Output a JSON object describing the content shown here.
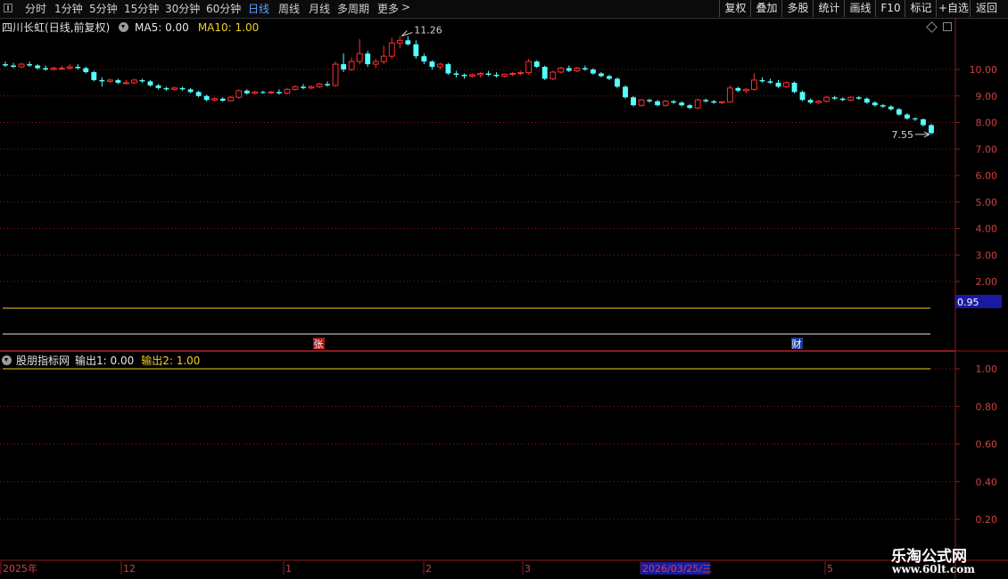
{
  "toolbar": {
    "periods": [
      "分时",
      "1分钟",
      "5分钟",
      "15分钟",
      "30分钟",
      "60分钟",
      "日线",
      "周线",
      "月线",
      "多周期",
      "更多"
    ],
    "more_arrow": ">",
    "active_period": "日线",
    "buttons": [
      "复权",
      "叠加",
      "多股",
      "统计",
      "画线",
      "F10",
      "标记",
      "+自选",
      "返回"
    ]
  },
  "main_panel": {
    "stock_name": "四川长虹",
    "mode": "(日线,前复权)",
    "ma5_label": "MA5: 0.00",
    "ma10_label": "MA10: 1.00",
    "high_marker": "11.26",
    "low_marker": "7.55",
    "current_value_tag": "0.95",
    "event_badges": [
      "张",
      "财"
    ]
  },
  "indicator_panel": {
    "name": "股朋指标网",
    "output1_label": "输出1: 0.00",
    "output2_label": "输出2: 1.00"
  },
  "time_axis": {
    "labels": [
      "2025年",
      "12",
      "1",
      "2",
      "3",
      "2026/03/25/三",
      "5"
    ]
  },
  "watermark": {
    "title": "乐淘公式网",
    "url": "www.60lt.com"
  },
  "colors": {
    "up": "#ff3030",
    "down": "#54ffff",
    "ma10_line": "#f0d020",
    "grid": "#8b1a1a",
    "axis_text": "#d04040",
    "active_tab": "#5aa0ff"
  },
  "chart_data": [
    {
      "type": "candlestick",
      "title": "四川长虹",
      "ylim": [
        1.5,
        11.8
      ],
      "yticks": [
        2.0,
        3.0,
        4.0,
        5.0,
        6.0,
        7.0,
        8.0,
        9.0,
        10.0
      ],
      "ohlc": [
        [
          10.2,
          10.3,
          10.1,
          10.15
        ],
        [
          10.15,
          10.25,
          10.05,
          10.1
        ],
        [
          10.1,
          10.25,
          10.05,
          10.2
        ],
        [
          10.2,
          10.3,
          10.1,
          10.15
        ],
        [
          10.15,
          10.2,
          10.0,
          10.05
        ],
        [
          10.05,
          10.15,
          9.95,
          10.0
        ],
        [
          10.0,
          10.1,
          9.95,
          10.05
        ],
        [
          10.05,
          10.15,
          9.98,
          10.05
        ],
        [
          10.05,
          10.2,
          10.0,
          10.1
        ],
        [
          10.1,
          10.2,
          10.0,
          10.05
        ],
        [
          10.05,
          10.1,
          9.85,
          9.9
        ],
        [
          9.9,
          9.95,
          9.55,
          9.6
        ],
        [
          9.6,
          9.7,
          9.35,
          9.55
        ],
        [
          9.55,
          9.65,
          9.5,
          9.6
        ],
        [
          9.6,
          9.65,
          9.45,
          9.5
        ],
        [
          9.5,
          9.6,
          9.45,
          9.5
        ],
        [
          9.5,
          9.65,
          9.45,
          9.6
        ],
        [
          9.6,
          9.65,
          9.5,
          9.55
        ],
        [
          9.55,
          9.6,
          9.35,
          9.4
        ],
        [
          9.4,
          9.45,
          9.25,
          9.3
        ],
        [
          9.3,
          9.35,
          9.2,
          9.25
        ],
        [
          9.25,
          9.35,
          9.2,
          9.3
        ],
        [
          9.3,
          9.35,
          9.2,
          9.25
        ],
        [
          9.25,
          9.3,
          9.1,
          9.15
        ],
        [
          9.15,
          9.2,
          8.95,
          9.0
        ],
        [
          9.0,
          9.05,
          8.8,
          8.85
        ],
        [
          8.85,
          8.95,
          8.8,
          8.9
        ],
        [
          8.9,
          8.95,
          8.78,
          8.82
        ],
        [
          8.82,
          9.0,
          8.8,
          8.95
        ],
        [
          8.95,
          9.25,
          8.9,
          9.2
        ],
        [
          9.2,
          9.25,
          9.05,
          9.1
        ],
        [
          9.1,
          9.2,
          9.05,
          9.15
        ],
        [
          9.15,
          9.2,
          9.08,
          9.12
        ],
        [
          9.12,
          9.2,
          9.08,
          9.15
        ],
        [
          9.15,
          9.25,
          9.05,
          9.1
        ],
        [
          9.1,
          9.3,
          9.05,
          9.25
        ],
        [
          9.25,
          9.4,
          9.2,
          9.35
        ],
        [
          9.35,
          9.45,
          9.25,
          9.3
        ],
        [
          9.3,
          9.4,
          9.25,
          9.35
        ],
        [
          9.35,
          9.5,
          9.3,
          9.45
        ],
        [
          9.45,
          9.55,
          9.35,
          9.4
        ],
        [
          9.4,
          10.3,
          9.35,
          10.2
        ],
        [
          10.2,
          10.6,
          9.9,
          10.0
        ],
        [
          10.0,
          10.45,
          9.95,
          10.3
        ],
        [
          10.3,
          11.15,
          10.2,
          10.6
        ],
        [
          10.6,
          10.7,
          10.1,
          10.2
        ],
        [
          10.2,
          10.4,
          10.05,
          10.3
        ],
        [
          10.3,
          10.9,
          10.2,
          10.5
        ],
        [
          10.5,
          11.2,
          10.4,
          11.0
        ],
        [
          11.0,
          11.26,
          10.8,
          11.1
        ],
        [
          11.1,
          11.26,
          10.9,
          10.95
        ],
        [
          10.95,
          11.1,
          10.4,
          10.5
        ],
        [
          10.5,
          10.6,
          10.2,
          10.3
        ],
        [
          10.3,
          10.35,
          10.0,
          10.1
        ],
        [
          10.1,
          10.25,
          10.0,
          10.2
        ],
        [
          10.2,
          10.25,
          9.8,
          9.85
        ],
        [
          9.85,
          9.95,
          9.7,
          9.8
        ],
        [
          9.8,
          9.85,
          9.65,
          9.75
        ],
        [
          9.75,
          9.85,
          9.7,
          9.8
        ],
        [
          9.8,
          9.9,
          9.7,
          9.85
        ],
        [
          9.85,
          9.95,
          9.75,
          9.8
        ],
        [
          9.8,
          9.9,
          9.7,
          9.75
        ],
        [
          9.75,
          9.85,
          9.7,
          9.82
        ],
        [
          9.82,
          9.9,
          9.75,
          9.85
        ],
        [
          9.85,
          9.95,
          9.78,
          9.88
        ],
        [
          9.88,
          10.4,
          9.8,
          10.3
        ],
        [
          10.3,
          10.35,
          10.05,
          10.1
        ],
        [
          10.1,
          10.15,
          9.6,
          9.65
        ],
        [
          9.65,
          9.95,
          9.6,
          9.9
        ],
        [
          9.9,
          10.1,
          9.85,
          10.05
        ],
        [
          10.05,
          10.15,
          9.9,
          9.95
        ],
        [
          9.95,
          10.1,
          9.9,
          10.05
        ],
        [
          10.05,
          10.15,
          9.95,
          10.0
        ],
        [
          10.0,
          10.05,
          9.8,
          9.85
        ],
        [
          9.85,
          9.9,
          9.7,
          9.75
        ],
        [
          9.75,
          9.8,
          9.6,
          9.65
        ],
        [
          9.65,
          9.7,
          9.3,
          9.35
        ],
        [
          9.35,
          9.4,
          8.9,
          8.95
        ],
        [
          8.95,
          9.0,
          8.6,
          8.65
        ],
        [
          8.65,
          8.9,
          8.6,
          8.85
        ],
        [
          8.85,
          8.9,
          8.75,
          8.8
        ],
        [
          8.8,
          8.85,
          8.6,
          8.65
        ],
        [
          8.65,
          8.85,
          8.6,
          8.8
        ],
        [
          8.8,
          8.85,
          8.7,
          8.75
        ],
        [
          8.75,
          8.8,
          8.6,
          8.65
        ],
        [
          8.65,
          8.7,
          8.5,
          8.55
        ],
        [
          8.55,
          8.9,
          8.5,
          8.85
        ],
        [
          8.85,
          8.9,
          8.75,
          8.8
        ],
        [
          8.8,
          8.85,
          8.7,
          8.75
        ],
        [
          8.75,
          8.8,
          8.7,
          8.78
        ],
        [
          8.78,
          9.4,
          8.75,
          9.3
        ],
        [
          9.3,
          9.35,
          9.15,
          9.2
        ],
        [
          9.2,
          9.3,
          9.1,
          9.25
        ],
        [
          9.25,
          9.85,
          9.2,
          9.6
        ],
        [
          9.6,
          9.7,
          9.5,
          9.55
        ],
        [
          9.55,
          9.65,
          9.45,
          9.5
        ],
        [
          9.5,
          9.6,
          9.3,
          9.35
        ],
        [
          9.35,
          9.55,
          9.3,
          9.5
        ],
        [
          9.5,
          9.55,
          9.1,
          9.15
        ],
        [
          9.15,
          9.2,
          8.8,
          8.85
        ],
        [
          8.85,
          8.9,
          8.7,
          8.75
        ],
        [
          8.75,
          8.85,
          8.7,
          8.8
        ],
        [
          8.8,
          9.0,
          8.75,
          8.95
        ],
        [
          8.95,
          9.0,
          8.85,
          8.9
        ],
        [
          8.9,
          8.95,
          8.8,
          8.85
        ],
        [
          8.85,
          9.0,
          8.8,
          8.95
        ],
        [
          8.95,
          9.0,
          8.85,
          8.9
        ],
        [
          8.9,
          8.95,
          8.7,
          8.75
        ],
        [
          8.75,
          8.8,
          8.6,
          8.65
        ],
        [
          8.65,
          8.7,
          8.55,
          8.6
        ],
        [
          8.6,
          8.65,
          8.45,
          8.5
        ],
        [
          8.5,
          8.55,
          8.25,
          8.3
        ],
        [
          8.3,
          8.35,
          8.1,
          8.15
        ],
        [
          8.15,
          8.2,
          8.05,
          8.12
        ],
        [
          8.12,
          8.15,
          7.85,
          7.9
        ],
        [
          7.9,
          7.95,
          7.55,
          7.6
        ]
      ],
      "hlines": [
        1.5,
        0.55
      ]
    },
    {
      "type": "line",
      "title": "股朋指标网",
      "ylim": [
        0.1,
        1.1
      ],
      "yticks": [
        0.2,
        0.4,
        0.6,
        0.8,
        1.0
      ],
      "series": [
        {
          "name": "输出1",
          "value": 0.0
        },
        {
          "name": "输出2",
          "value": 1.0
        }
      ]
    }
  ]
}
